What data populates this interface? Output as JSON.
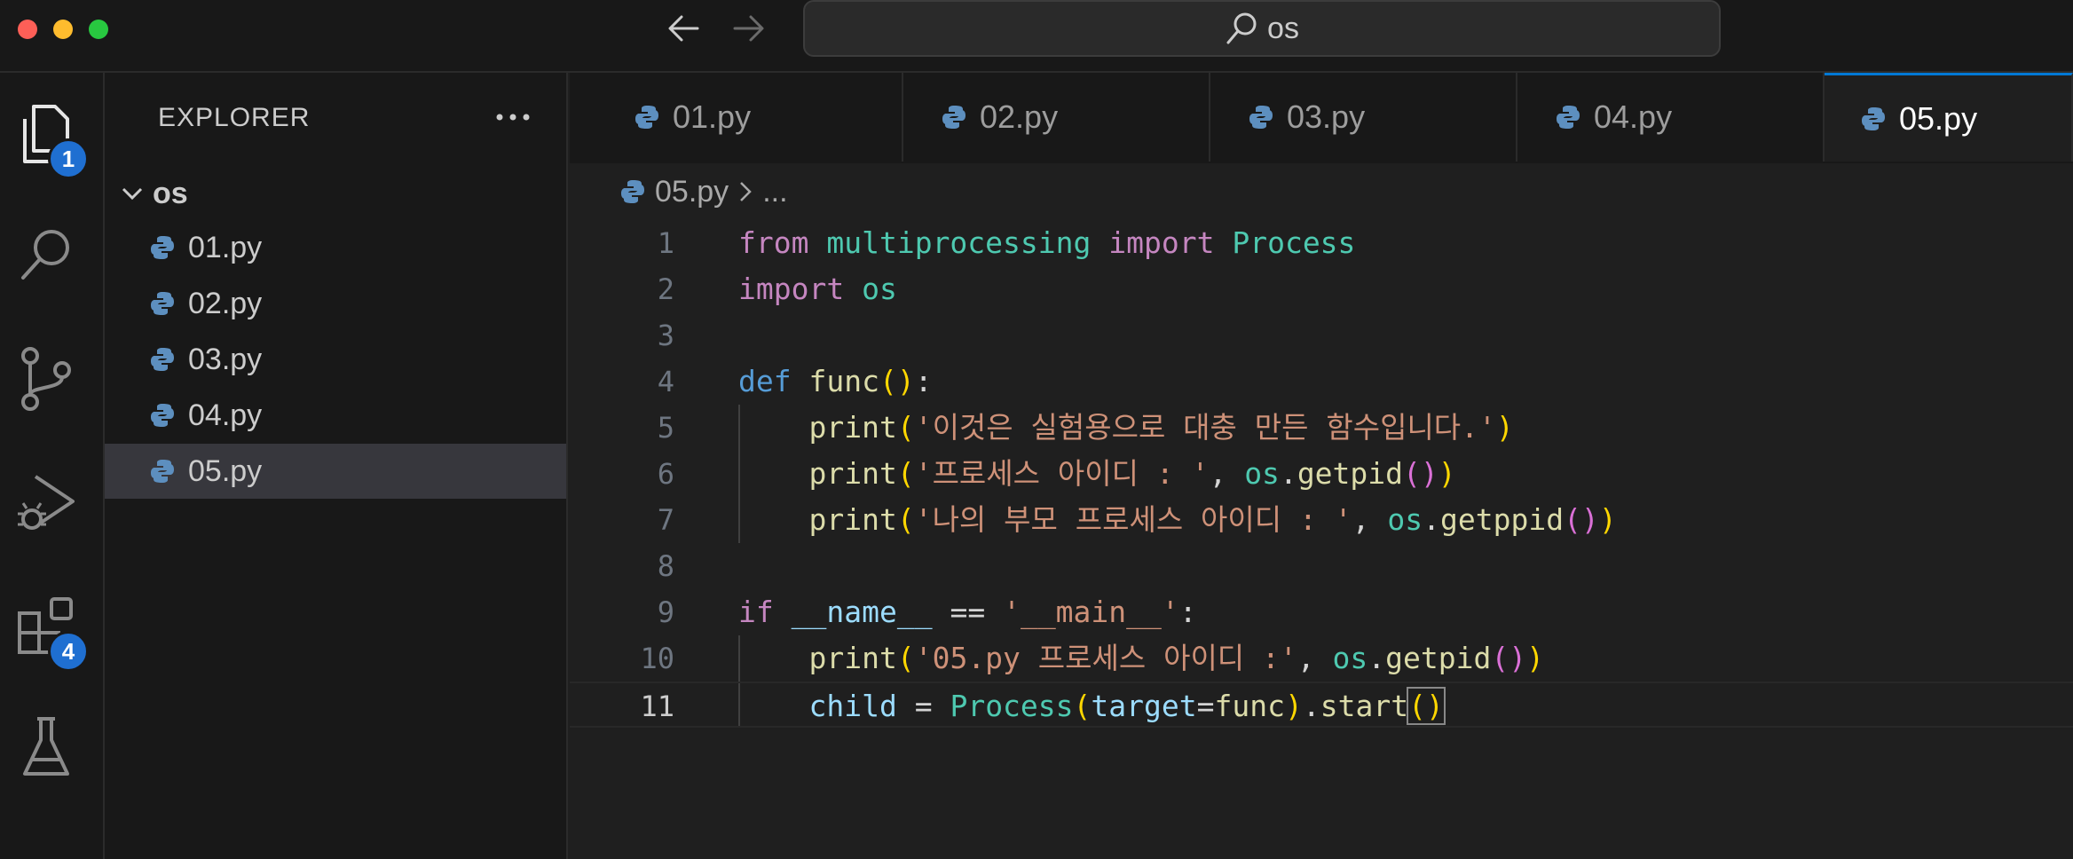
{
  "window": {
    "command_center": "os"
  },
  "activity_bar": {
    "explorer_badge": "1",
    "extensions_badge": "4"
  },
  "sidebar": {
    "title": "EXPLORER",
    "folder": "os",
    "files": [
      "01.py",
      "02.py",
      "03.py",
      "04.py",
      "05.py"
    ],
    "selected_file": "05.py"
  },
  "tabs": [
    {
      "label": "01.py",
      "active": false
    },
    {
      "label": "02.py",
      "active": false
    },
    {
      "label": "03.py",
      "active": false
    },
    {
      "label": "04.py",
      "active": false
    },
    {
      "label": "05.py",
      "active": true
    }
  ],
  "breadcrumb": {
    "file": "05.py",
    "more": "..."
  },
  "editor": {
    "current_line": "11",
    "line_numbers": [
      "1",
      "2",
      "3",
      "4",
      "5",
      "6",
      "7",
      "8",
      "9",
      "10",
      "11"
    ],
    "tokens": {
      "l1": [
        "from",
        "multiprocessing",
        "import",
        "Process"
      ],
      "l2": [
        "import",
        "os"
      ],
      "l4": [
        "def",
        "func",
        "(",
        ")",
        ":"
      ],
      "l5": [
        "print",
        "(",
        "'이것은 실험용으로 대충 만든 함수입니다.'",
        ")"
      ],
      "l6": [
        "print",
        "(",
        "'프로세스 아이디 : '",
        ", ",
        "os",
        ".",
        "getpid",
        "()",
        ")"
      ],
      "l7": [
        "print",
        "(",
        "'나의 부모 프로세스 아이디 : '",
        ", ",
        "os",
        ".",
        "getppid",
        "()",
        ")"
      ],
      "l9": [
        "if",
        "__name__",
        "==",
        "'__main__'",
        ":"
      ],
      "l10": [
        "print",
        "(",
        "'05.py 프로세스 아이디 :'",
        ", ",
        "os",
        ".",
        "getpid",
        "()",
        ")"
      ],
      "l11": [
        "child",
        "=",
        "Process",
        "(",
        "target",
        "=",
        "func",
        ")",
        ".",
        "start",
        "()"
      ]
    }
  },
  "colors": {
    "keyword": "#c586c0",
    "def": "#569cd6",
    "module": "#4ec9b0",
    "function": "#dcdcaa",
    "string": "#ce9178",
    "variable": "#9cdcfe",
    "bracket_1": "#ffd700",
    "bracket_2": "#da70d6",
    "accent": "#0078d4",
    "badge": "#1f6fd1"
  }
}
